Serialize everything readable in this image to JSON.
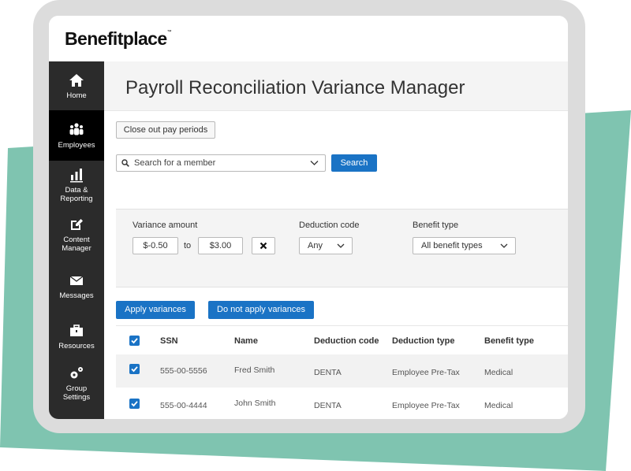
{
  "brand": {
    "logo_text": "Benefitplace",
    "logo_mark": "™"
  },
  "colors": {
    "teal": "#7fc4b0",
    "accent": "#1a73c5",
    "sidebar": "#2b2b2b",
    "sidebar_active": "#000000"
  },
  "sidebar": {
    "items": [
      {
        "label": "Home",
        "icon": "home-icon"
      },
      {
        "label": "Employees",
        "icon": "people-icon",
        "active": true
      },
      {
        "label": "Data &",
        "label2": "Reporting",
        "icon": "bar-chart-icon"
      },
      {
        "label": "Content",
        "label2": "Manager",
        "icon": "edit-icon"
      },
      {
        "label": "Messages",
        "icon": "envelope-icon"
      },
      {
        "label": "Resources",
        "icon": "briefcase-icon"
      },
      {
        "label": "Group",
        "label2": "Settings",
        "icon": "gears-icon"
      }
    ]
  },
  "page": {
    "title": "Payroll Reconciliation Variance Manager"
  },
  "actions": {
    "close_out": "Close out pay periods",
    "search_placeholder": "Search for a member",
    "search_button": "Search",
    "apply": "Apply variances",
    "do_not_apply": "Do not apply variances"
  },
  "filters": {
    "variance_label": "Variance amount",
    "variance_min": "$-0.50",
    "to_label": "to",
    "variance_max": "$3.00",
    "clear_icon": "x-icon",
    "deduction_label": "Deduction code",
    "deduction_value": "Any",
    "benefit_label": "Benefit type",
    "benefit_value": "All benefit types"
  },
  "table": {
    "columns": [
      "SSN",
      "Name",
      "Deduction code",
      "Deduction type",
      "Benefit type"
    ],
    "rows": [
      {
        "ssn": "555-00-5556",
        "name": "Fred Smith",
        "deduction_code": "DENTA",
        "deduction_type": "Employee Pre-Tax",
        "benefit_type": "Medical",
        "checked": true
      },
      {
        "ssn": "555-00-4444",
        "name": "John Smith",
        "deduction_code": "DENTA",
        "deduction_type": "Employee Pre-Tax",
        "benefit_type": "Medical",
        "checked": true
      }
    ]
  }
}
